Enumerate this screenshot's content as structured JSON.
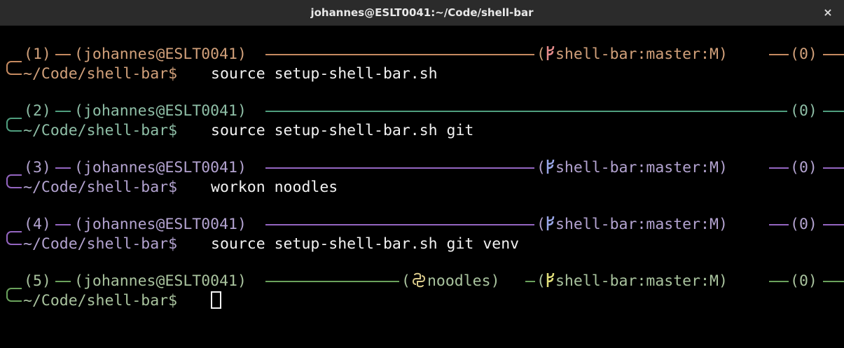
{
  "window": {
    "title": "johannes@ESLT0041:~/Code/shell-bar",
    "close_glyph": "×"
  },
  "prompts": [
    {
      "num": "1",
      "user_host": "johannes@ESLT0041",
      "git": "shell-bar:master:M",
      "exit": "0",
      "cwd": "~/Code/shell-bar$",
      "command": "source setup-shell-bar.sh",
      "color": "#c58a60"
    },
    {
      "num": "2",
      "user_host": "johannes@ESLT0041",
      "exit": "0",
      "cwd": "~/Code/shell-bar$",
      "command": "source setup-shell-bar.sh git",
      "color": "#4f9e7e"
    },
    {
      "num": "3",
      "user_host": "johannes@ESLT0041",
      "git": "shell-bar:master:M",
      "exit": "0",
      "cwd": "~/Code/shell-bar$",
      "command": "workon noodles",
      "color": "#9465c1"
    },
    {
      "num": "4",
      "user_host": "johannes@ESLT0041",
      "git": "shell-bar:master:M",
      "exit": "0",
      "cwd": "~/Code/shell-bar$",
      "command": "source setup-shell-bar.sh git venv",
      "color": "#9465c1"
    },
    {
      "num": "5",
      "user_host": "johannes@ESLT0041",
      "venv": "noodles",
      "git": "shell-bar:master:M",
      "exit": "0",
      "cwd": "~/Code/shell-bar$",
      "command": "",
      "color": "#6aa25c"
    }
  ],
  "text_colors": {
    "p1": "#d1a07a",
    "p2": "#8fbfa7",
    "p3": "#b3a3d0",
    "p4": "#b3a3d0",
    "p5": "#a9c39e"
  },
  "icons": {
    "git": "git-branch-icon",
    "venv": "python-icon",
    "cursor": "terminal-cursor"
  }
}
